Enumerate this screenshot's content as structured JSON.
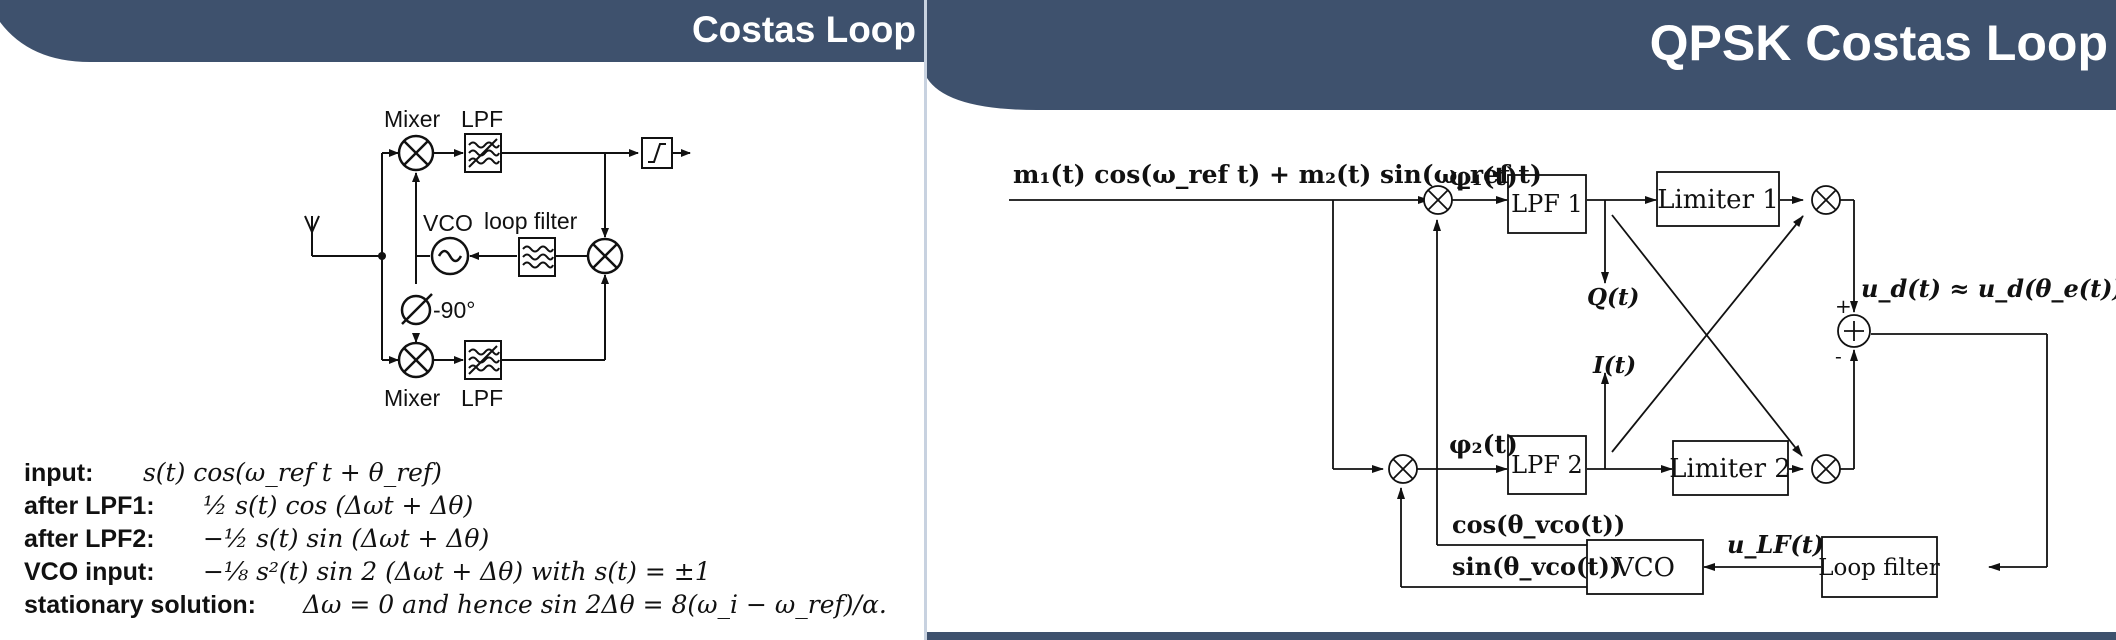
{
  "left_slide": {
    "title": "Costas Loop",
    "diagram": {
      "mixer_top": "Mixer",
      "lpf_top": "LPF",
      "vco": "VCO",
      "loop_filter": "loop filter",
      "phase_shift": "-90°",
      "mixer_bottom": "Mixer",
      "lpf_bottom": "LPF"
    },
    "equations": [
      {
        "label": "input:",
        "expr": "s(t) cos(ω_ref t + θ_ref)"
      },
      {
        "label": "after LPF1:",
        "expr": "½ s(t) cos (Δωt + Δθ)"
      },
      {
        "label": "after LPF2:",
        "expr": "−½ s(t) sin (Δωt + Δθ)"
      },
      {
        "label": "VCO input:",
        "expr": "−⅛ s²(t) sin 2 (Δωt + Δθ) with s(t) = ±1"
      },
      {
        "label": "stationary solution:",
        "expr": "Δω = 0 and hence sin 2Δθ = 8(ω_i − ω_ref)/α."
      }
    ]
  },
  "right_slide": {
    "title": "QPSK Costas Loop",
    "diagram": {
      "input_signal": "m₁(t) cos(ω_ref t) + m₂(t) sin(ω_ref t)",
      "phi1": "φ₁(t)",
      "phi2": "φ₂(t)",
      "lpf1": "LPF 1",
      "lpf2": "LPF 2",
      "limiter1": "Limiter 1",
      "limiter2": "Limiter 2",
      "q_label": "Q(t)",
      "i_label": "I(t)",
      "ud_label": "u_d(t) ≈ u_d(θ_e(t))",
      "plus": "+",
      "minus": "-",
      "cos_vco": "cos(θ_vco(t))",
      "sin_vco": "sin(θ_vco(t))",
      "vco": "VCO",
      "ulf_label": "u_LF(t)",
      "loop_filter": "Loop filter"
    }
  },
  "colors": {
    "header": "#3e516d",
    "line": "#111111"
  }
}
